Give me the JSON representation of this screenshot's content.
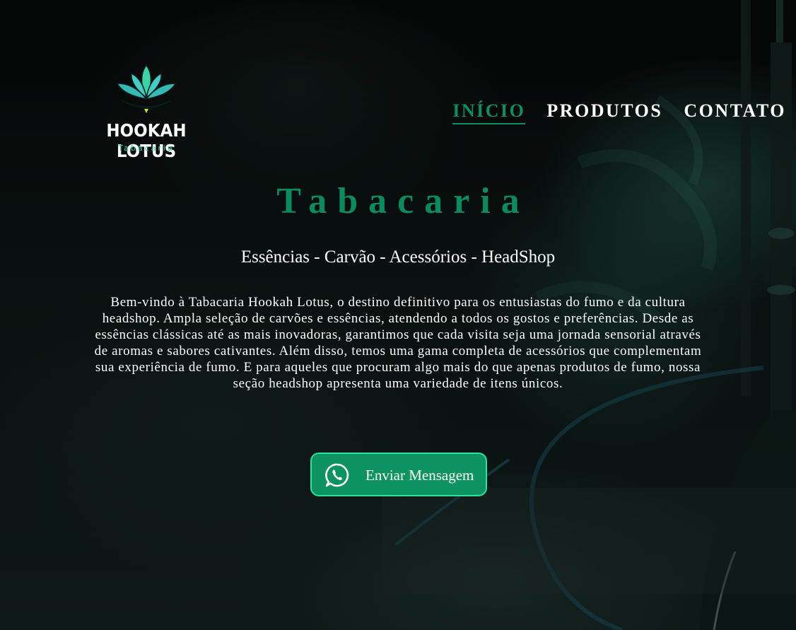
{
  "logo": {
    "name": "HOOKAH LOTUS",
    "subtitle": "Tabacaria",
    "icon": "lotus-icon"
  },
  "nav": {
    "items": [
      {
        "label": "INÍCIO",
        "active": true
      },
      {
        "label": "PRODUTOS",
        "active": false
      },
      {
        "label": "CONTATO",
        "active": false
      }
    ]
  },
  "hero": {
    "title": "Tabacaria",
    "subtitle": "Essências - Carvão - Acessórios - HeadShop",
    "description": "Bem-vindo à Tabacaria Hookah Lotus, o destino definitivo para os entusiastas do fumo e da cultura headshop. Ampla seleção de carvões e essências, atendendo a todos os gostos e preferências. Desde as essências clássicas até as mais inovadoras, garantimos que cada visita seja uma jornada sensorial através de aromas e sabores cativantes. Além disso, temos uma gama completa de acessórios que complementam sua experiência de fumo. E para aqueles que procuram algo mais do que apenas produtos de fumo, nossa seção headshop apresenta uma variedade de itens únicos."
  },
  "cta": {
    "label": "Enviar Mensagem",
    "icon": "whatsapp-icon"
  },
  "colors": {
    "accent": "#0d8d62",
    "button_bg": "#0d9262",
    "button_border": "#2be3a0",
    "logo_teal": "#3fd1a6",
    "logo_lime": "#c6e33a"
  }
}
